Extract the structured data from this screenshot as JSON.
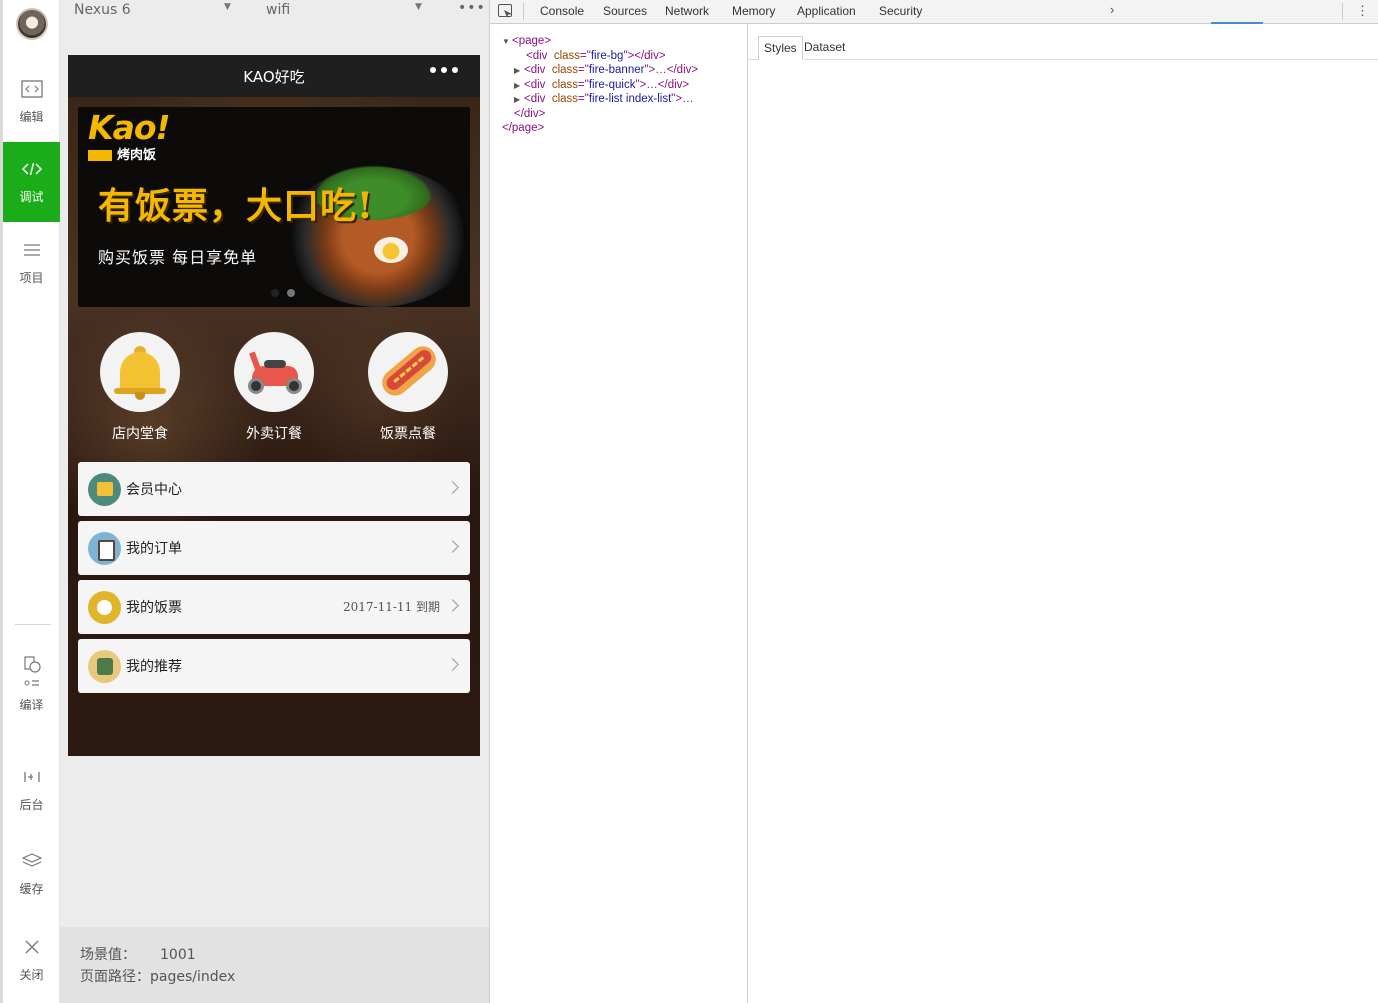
{
  "nav": {
    "items": [
      {
        "label": "编辑",
        "icon": "code-editor-icon"
      },
      {
        "label": "调试",
        "icon": "debug-icon",
        "active": true
      },
      {
        "label": "项目",
        "icon": "menu-icon"
      },
      {
        "label": "编译",
        "icon": "compile-icon"
      },
      {
        "label": "后台",
        "icon": "backend-icon"
      },
      {
        "label": "缓存",
        "icon": "layers-icon"
      },
      {
        "label": "关闭",
        "icon": "close-icon"
      }
    ],
    "active_color": "#1aad19"
  },
  "simulator": {
    "device": "Nexus 6",
    "network": "wifi",
    "app": {
      "title": "KAO好吃",
      "banner": {
        "logo": "Kao!",
        "logo_sub": "烤肉饭",
        "headline": "有饭票，大口吃!",
        "subline": "购买饭票  每日享免单"
      },
      "quick": [
        {
          "label": "店内堂食",
          "icon": "bell-icon"
        },
        {
          "label": "外卖订餐",
          "icon": "scooter-icon"
        },
        {
          "label": "饭票点餐",
          "icon": "hotdog-icon"
        }
      ],
      "menu": [
        {
          "label": "会员中心",
          "extra": "",
          "icon": "vip-card-icon"
        },
        {
          "label": "我的订单",
          "extra": "",
          "icon": "clipboard-icon"
        },
        {
          "label": "我的饭票",
          "extra": "2017-11-11 到期",
          "icon": "plate-icon"
        },
        {
          "label": "我的推荐",
          "extra": "",
          "icon": "recommend-icon"
        }
      ]
    },
    "footer": {
      "scene_label": "场景值：",
      "scene_value": "1001",
      "path_label": "页面路径：",
      "path_value": "pages/index"
    }
  },
  "devtools": {
    "tabs": [
      "Console",
      "Sources",
      "Network",
      "Memory",
      "Application",
      "Security"
    ],
    "more": "›",
    "dom": {
      "page_open": "<page>",
      "rows": [
        {
          "cls": "fire-bg",
          "tail": "></div>",
          "expandable": false
        },
        {
          "cls": "fire-banner",
          "tail": ">…</div>",
          "expandable": true
        },
        {
          "cls": "fire-quick",
          "tail": ">…</div>",
          "expandable": true
        },
        {
          "cls": "fire-list index-list",
          "tail": ">…",
          "expandable": true
        }
      ],
      "div_close": "</div>",
      "page_close": "</page>"
    },
    "side_tabs": [
      "Styles",
      "Dataset"
    ]
  }
}
